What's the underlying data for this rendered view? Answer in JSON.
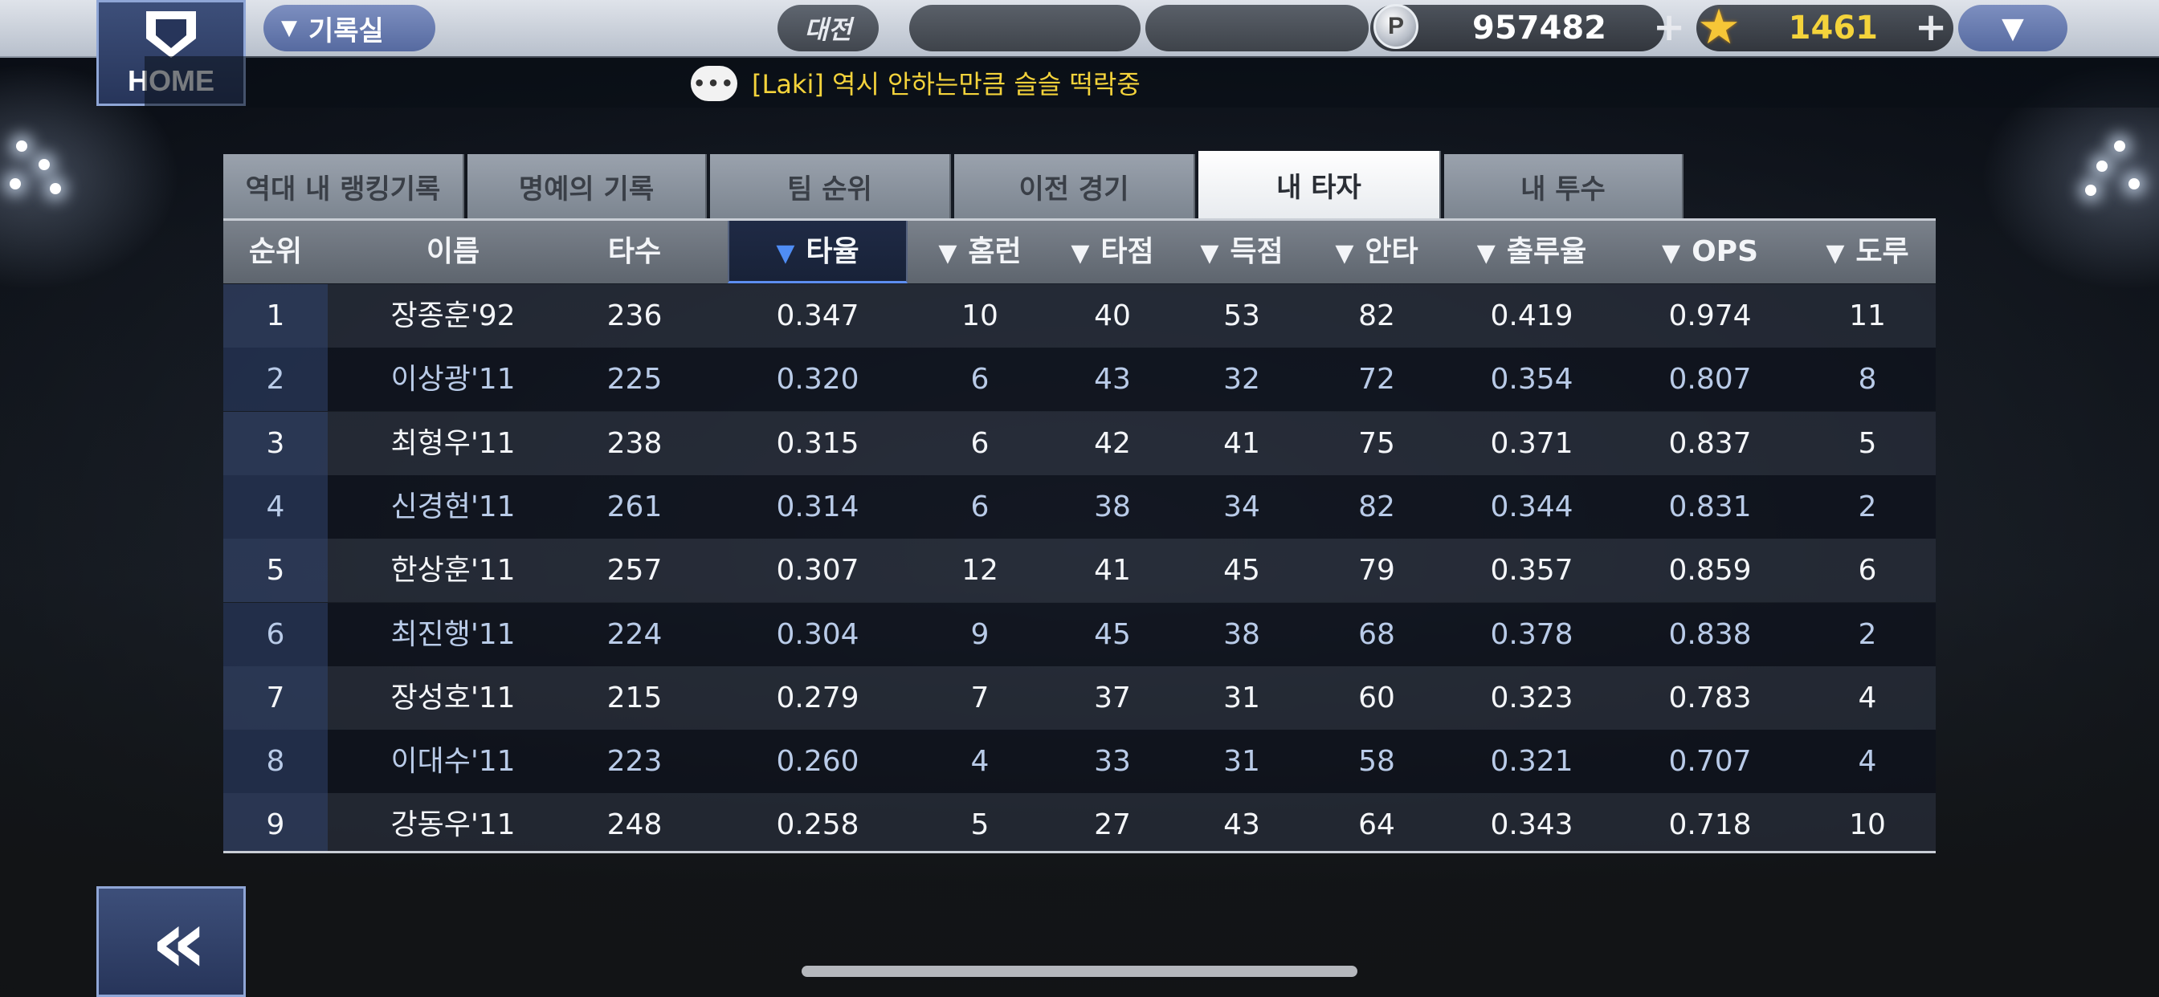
{
  "colors": {
    "accent": "#5d8ef0",
    "gold": "#f4d33b",
    "nav_blue": "#566aa0"
  },
  "topbar": {
    "home_label": "HOME",
    "menu_label": "기록실",
    "vs_label": "대전",
    "points_icon": "P",
    "points": "957482",
    "stars": "1461"
  },
  "ticker": {
    "bubble_icon": "chat-bubble-icon",
    "message": "[Laki] 역시 안하는만큼 슬슬 떡락중"
  },
  "tabs": [
    {
      "label": "역대 내 랭킹기록"
    },
    {
      "label": "명예의 기록"
    },
    {
      "label": "팀 순위"
    },
    {
      "label": "이전 경기"
    },
    {
      "label": "내 타자",
      "active": true
    },
    {
      "label": "내 투수"
    }
  ],
  "table": {
    "headers": [
      "순위",
      "이름",
      "타수",
      "타율",
      "홈런",
      "타점",
      "득점",
      "안타",
      "출루율",
      "OPS",
      "도루"
    ],
    "sorted_column": "타율",
    "rows": [
      [
        "1",
        "장종훈'92",
        "236",
        "0.347",
        "10",
        "40",
        "53",
        "82",
        "0.419",
        "0.974",
        "11"
      ],
      [
        "2",
        "이상광'11",
        "225",
        "0.320",
        "6",
        "43",
        "32",
        "72",
        "0.354",
        "0.807",
        "8"
      ],
      [
        "3",
        "최형우'11",
        "238",
        "0.315",
        "6",
        "42",
        "41",
        "75",
        "0.371",
        "0.837",
        "5"
      ],
      [
        "4",
        "신경현'11",
        "261",
        "0.314",
        "6",
        "38",
        "34",
        "82",
        "0.344",
        "0.831",
        "2"
      ],
      [
        "5",
        "한상훈'11",
        "257",
        "0.307",
        "12",
        "41",
        "45",
        "79",
        "0.357",
        "0.859",
        "6"
      ],
      [
        "6",
        "최진행'11",
        "224",
        "0.304",
        "9",
        "45",
        "38",
        "68",
        "0.378",
        "0.838",
        "2"
      ],
      [
        "7",
        "장성호'11",
        "215",
        "0.279",
        "7",
        "37",
        "31",
        "60",
        "0.323",
        "0.783",
        "4"
      ],
      [
        "8",
        "이대수'11",
        "223",
        "0.260",
        "4",
        "33",
        "31",
        "58",
        "0.321",
        "0.707",
        "4"
      ],
      [
        "9",
        "강동우'11",
        "248",
        "0.258",
        "5",
        "27",
        "43",
        "64",
        "0.343",
        "0.718",
        "10"
      ]
    ]
  }
}
